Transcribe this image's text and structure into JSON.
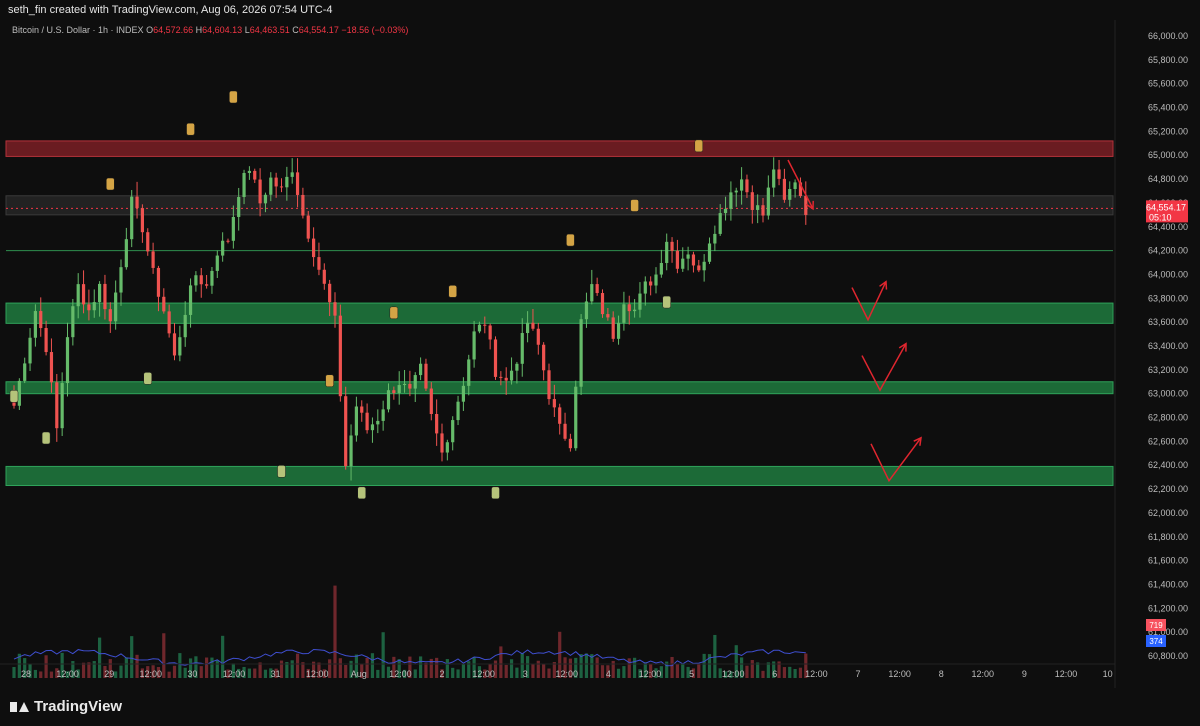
{
  "header": {
    "attribution": "seth_fin created with TradingView.com, Aug 06, 2026 07:54 UTC-4"
  },
  "legend": {
    "symbol": "Bitcoin / U.S. Dollar · 1h · INDEX",
    "o_label": "O",
    "o_value": "64,572.66",
    "h_label": "H",
    "h_value": "64,604.13",
    "l_label": "L",
    "l_value": "64,463.51",
    "c_label": "C",
    "c_value": "64,554.17",
    "change": "−18.56 (−0.03%)"
  },
  "price_tag": {
    "value": "64,554.17",
    "timer": "05:10",
    "color": "#f23645"
  },
  "volume_tags": [
    {
      "value": "719",
      "color": "#f7525f"
    },
    {
      "value": "374",
      "color": "#2962ff"
    }
  ],
  "footer": {
    "brand": "TradingView"
  },
  "colors": {
    "up": "#66bb6a",
    "down": "#ef5350",
    "resistance": "#7a1f24",
    "support": "#1e7a3e",
    "marker": "#d4a445"
  },
  "chart_data": {
    "type": "candlestick",
    "instrument": "Bitcoin / U.S. Dollar",
    "interval": "1h",
    "y_axis_ticks": [
      "66,000.00",
      "65,800.00",
      "65,600.00",
      "65,400.00",
      "65,200.00",
      "65,000.00",
      "64,800.00",
      "64,600.00",
      "64,400.00",
      "64,200.00",
      "64,000.00",
      "63,800.00",
      "63,600.00",
      "63,400.00",
      "63,200.00",
      "63,000.00",
      "62,800.00",
      "62,600.00",
      "62,400.00",
      "62,200.00",
      "62,000.00",
      "61,800.00",
      "61,600.00",
      "61,400.00",
      "61,200.00",
      "61,000.00",
      "60,800.00"
    ],
    "x_axis_ticks": [
      "28",
      "12:00",
      "29",
      "12:00",
      "30",
      "12:00",
      "31",
      "12:00",
      "Aug",
      "12:00",
      "2",
      "12:00",
      "3",
      "12:00",
      "4",
      "12:00",
      "5",
      "12:00",
      "6",
      "12:00",
      "7",
      "12:00",
      "8",
      "12:00",
      "9",
      "12:00",
      "10"
    ],
    "ylim": [
      60800,
      66000
    ],
    "zones": [
      {
        "kind": "resistance",
        "from": 64990,
        "to": 65120
      },
      {
        "kind": "neutral",
        "from": 64500,
        "to": 64660
      },
      {
        "kind": "support",
        "from": 63590,
        "to": 63760
      },
      {
        "kind": "support",
        "from": 63000,
        "to": 63100
      },
      {
        "kind": "support",
        "from": 62230,
        "to": 62390
      }
    ],
    "horizontal_line": 64200,
    "last_price": 64554.17,
    "close_path": [
      [
        0,
        62900
      ],
      [
        2,
        63300
      ],
      [
        4,
        63700
      ],
      [
        6,
        63400
      ],
      [
        8,
        62700
      ],
      [
        10,
        63500
      ],
      [
        12,
        63900
      ],
      [
        14,
        63700
      ],
      [
        16,
        63900
      ],
      [
        18,
        63600
      ],
      [
        20,
        64100
      ],
      [
        22,
        64600
      ],
      [
        24,
        64400
      ],
      [
        26,
        64000
      ],
      [
        28,
        63700
      ],
      [
        30,
        63300
      ],
      [
        32,
        63700
      ],
      [
        34,
        64000
      ],
      [
        36,
        63900
      ],
      [
        38,
        64200
      ],
      [
        40,
        64300
      ],
      [
        42,
        64700
      ],
      [
        44,
        64900
      ],
      [
        46,
        64600
      ],
      [
        48,
        64800
      ],
      [
        50,
        64700
      ],
      [
        52,
        64900
      ],
      [
        54,
        64500
      ],
      [
        56,
        64200
      ],
      [
        58,
        63900
      ],
      [
        60,
        63600
      ],
      [
        62,
        62400
      ],
      [
        64,
        62900
      ],
      [
        66,
        62700
      ],
      [
        68,
        62800
      ],
      [
        70,
        63000
      ],
      [
        72,
        63100
      ],
      [
        74,
        63000
      ],
      [
        76,
        63200
      ],
      [
        78,
        62800
      ],
      [
        80,
        62500
      ],
      [
        82,
        62800
      ],
      [
        84,
        63100
      ],
      [
        86,
        63500
      ],
      [
        88,
        63600
      ],
      [
        90,
        63200
      ],
      [
        92,
        63100
      ],
      [
        94,
        63300
      ],
      [
        96,
        63600
      ],
      [
        98,
        63400
      ],
      [
        100,
        63000
      ],
      [
        102,
        62700
      ],
      [
        104,
        62600
      ],
      [
        106,
        63600
      ],
      [
        108,
        63900
      ],
      [
        110,
        63700
      ],
      [
        112,
        63500
      ],
      [
        114,
        63800
      ],
      [
        116,
        63700
      ],
      [
        118,
        63900
      ],
      [
        120,
        64000
      ],
      [
        122,
        64300
      ],
      [
        124,
        64100
      ],
      [
        126,
        64200
      ],
      [
        128,
        64000
      ],
      [
        130,
        64300
      ],
      [
        132,
        64500
      ],
      [
        134,
        64700
      ],
      [
        136,
        64800
      ],
      [
        138,
        64600
      ],
      [
        140,
        64500
      ],
      [
        142,
        64900
      ],
      [
        144,
        64600
      ],
      [
        146,
        64800
      ],
      [
        148,
        64550
      ]
    ],
    "markers": [
      {
        "pos": "low",
        "t": 0,
        "price": 62970
      },
      {
        "pos": "low",
        "t": 6,
        "price": 62620
      },
      {
        "pos": "high",
        "t": 18,
        "price": 64750
      },
      {
        "pos": "low",
        "t": 25,
        "price": 63120
      },
      {
        "pos": "high",
        "t": 33,
        "price": 65210
      },
      {
        "pos": "high",
        "t": 41,
        "price": 65480
      },
      {
        "pos": "low",
        "t": 50,
        "price": 62340
      },
      {
        "pos": "high",
        "t": 59,
        "price": 63100
      },
      {
        "pos": "low",
        "t": 65,
        "price": 62160
      },
      {
        "pos": "high",
        "t": 71,
        "price": 63670
      },
      {
        "pos": "high",
        "t": 82,
        "price": 63850
      },
      {
        "pos": "low",
        "t": 90,
        "price": 62160
      },
      {
        "pos": "high",
        "t": 104,
        "price": 64280
      },
      {
        "pos": "high",
        "t": 116,
        "price": 64570
      },
      {
        "pos": "low",
        "t": 122,
        "price": 63760
      },
      {
        "pos": "high",
        "t": 128,
        "price": 65070
      }
    ],
    "projections": [
      {
        "points": [
          [
            64960,
            0
          ],
          [
            64550,
            1
          ]
        ]
      },
      {
        "points": [
          [
            63890,
            0
          ],
          [
            63620,
            1
          ],
          [
            63940,
            2
          ]
        ]
      },
      {
        "points": [
          [
            63320,
            0
          ],
          [
            63030,
            1
          ],
          [
            63420,
            2
          ]
        ]
      },
      {
        "points": [
          [
            62580,
            0
          ],
          [
            62270,
            1
          ],
          [
            62630,
            2
          ]
        ]
      }
    ]
  }
}
